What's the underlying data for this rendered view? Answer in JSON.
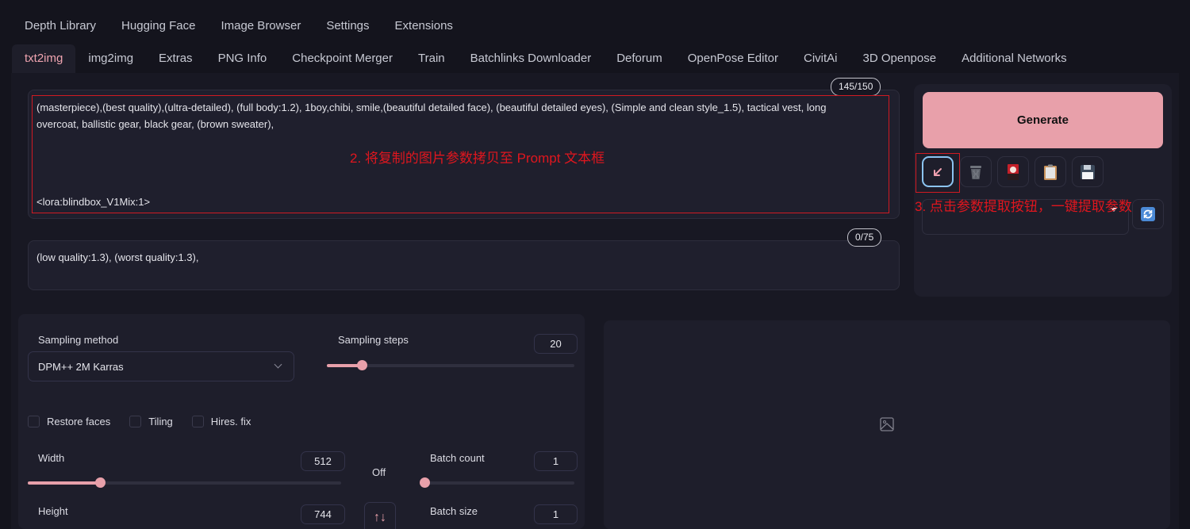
{
  "top_tabs": [
    "Depth Library",
    "Hugging Face",
    "Image Browser",
    "Settings",
    "Extensions"
  ],
  "sub_tabs": [
    {
      "label": "txt2img",
      "active": true
    },
    {
      "label": "img2img",
      "active": false
    },
    {
      "label": "Extras",
      "active": false
    },
    {
      "label": "PNG Info",
      "active": false
    },
    {
      "label": "Checkpoint Merger",
      "active": false
    },
    {
      "label": "Train",
      "active": false
    },
    {
      "label": "Batchlinks Downloader",
      "active": false
    },
    {
      "label": "Deforum",
      "active": false
    },
    {
      "label": "OpenPose Editor",
      "active": false
    },
    {
      "label": "CivitAi",
      "active": false
    },
    {
      "label": "3D Openpose",
      "active": false
    },
    {
      "label": "Additional Networks",
      "active": false
    }
  ],
  "prompt": {
    "text": "(masterpiece),(best quality),(ultra-detailed), (full body:1.2), 1boy,chibi, smile,(beautiful detailed face), (beautiful detailed eyes), (Simple and clean style_1.5), tactical vest, long overcoat, ballistic gear, black gear, (brown sweater),",
    "lora": "<lora:blindbox_V1Mix:1>",
    "token_counter": "145/150"
  },
  "negative_prompt": {
    "text": "(low quality:1.3), (worst quality:1.3),",
    "token_counter": "0/75"
  },
  "annotations": {
    "prompt_note": "2. 将复制的图片参数拷贝至 Prompt 文本框",
    "button_note": "3. 点击参数提取按钮，一键提取参数"
  },
  "right_panel": {
    "generate_label": "Generate",
    "tool_buttons": [
      {
        "icon": "read-params-arrow-icon"
      },
      {
        "icon": "trash-icon"
      },
      {
        "icon": "red-card-icon"
      },
      {
        "icon": "clipboard-icon"
      },
      {
        "icon": "save-floppy-icon"
      }
    ],
    "styles_value": "",
    "refresh_icon": "refresh-icon"
  },
  "settings": {
    "sampling_method_label": "Sampling method",
    "sampling_method_value": "DPM++ 2M Karras",
    "sampling_steps_label": "Sampling steps",
    "sampling_steps_value": "20",
    "sampling_steps_fraction": 0.14,
    "checkboxes": [
      {
        "label": "Restore faces",
        "checked": false
      },
      {
        "label": "Tiling",
        "checked": false
      },
      {
        "label": "Hires. fix",
        "checked": false
      }
    ],
    "width_label": "Width",
    "width_value": "512",
    "width_fraction": 0.23,
    "height_label": "Height",
    "height_value": "744",
    "off_label": "Off",
    "swap_icon": "↑↓",
    "batch_count_label": "Batch count",
    "batch_count_value": "1",
    "batch_count_fraction": 0.0,
    "batch_size_label": "Batch size",
    "batch_size_value": "1"
  },
  "output": {
    "placeholder_icon": "image-icon"
  }
}
